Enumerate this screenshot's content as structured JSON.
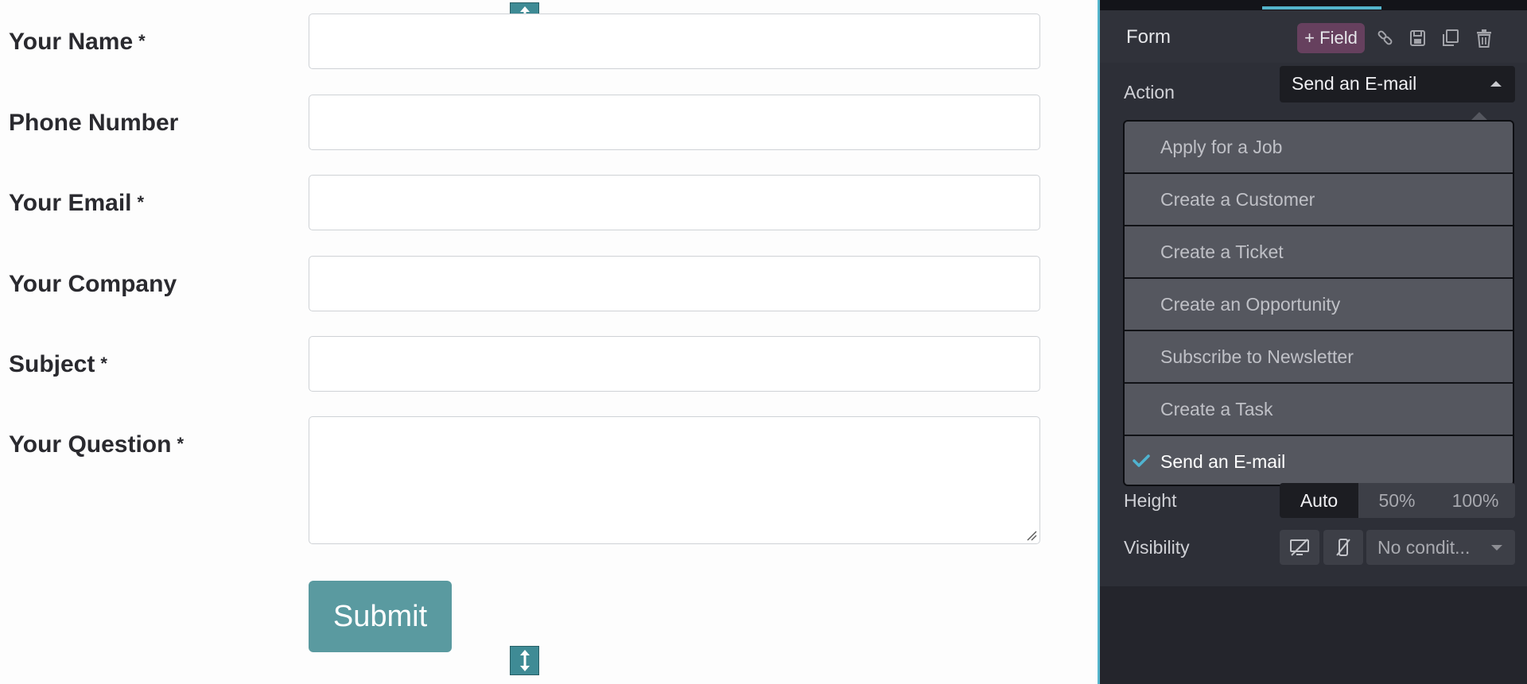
{
  "form": {
    "fields": [
      {
        "label": "Your Name",
        "required_mark": "*"
      },
      {
        "label": "Phone Number",
        "required_mark": ""
      },
      {
        "label": "Your Email",
        "required_mark": "*"
      },
      {
        "label": "Your Company",
        "required_mark": ""
      },
      {
        "label": "Subject",
        "required_mark": "*"
      },
      {
        "label": "Your Question",
        "required_mark": "*"
      }
    ],
    "submit_label": "Submit",
    "handle_icon": "vertical-resize-arrow-icon"
  },
  "editor": {
    "section_title": "Form",
    "add_field_label": "+ Field",
    "header_icons": [
      "link-icon",
      "save-icon",
      "duplicate-icon",
      "trash-icon"
    ],
    "action": {
      "label": "Action",
      "selected": "Send an E-mail",
      "options": [
        "Apply for a Job",
        "Create a Customer",
        "Create a Ticket",
        "Create an Opportunity",
        "Subscribe to Newsletter",
        "Create a Task",
        "Send an E-mail"
      ]
    },
    "height": {
      "label": "Height",
      "options": [
        "Auto",
        "50%",
        "100%"
      ],
      "selected": "Auto"
    },
    "visibility": {
      "label": "Visibility",
      "select_value": "No condit..."
    }
  },
  "colors": {
    "accent": "#54b4cb",
    "submit": "#5a9aa0",
    "add_field": "#66405e",
    "sidebar_bg": "#2d2f37"
  }
}
